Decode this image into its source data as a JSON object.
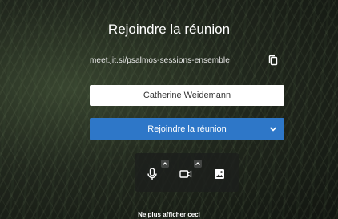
{
  "prejoin": {
    "title": "Rejoindre la réunion",
    "meeting_url": "meet.jit.si/psalmos-sessions-ensemble",
    "name_value": "Catherine Weidemann",
    "join_label": "Rejoindre la réunion",
    "dont_show_label": "Ne plus afficher ceci"
  },
  "toolbar": {
    "icons": [
      "microphone-icon",
      "camera-icon",
      "background-icon"
    ]
  },
  "colors": {
    "primary": "#2e77c8",
    "toolbar_bg": "#1c1e1c",
    "input_bg": "#ffffff"
  }
}
